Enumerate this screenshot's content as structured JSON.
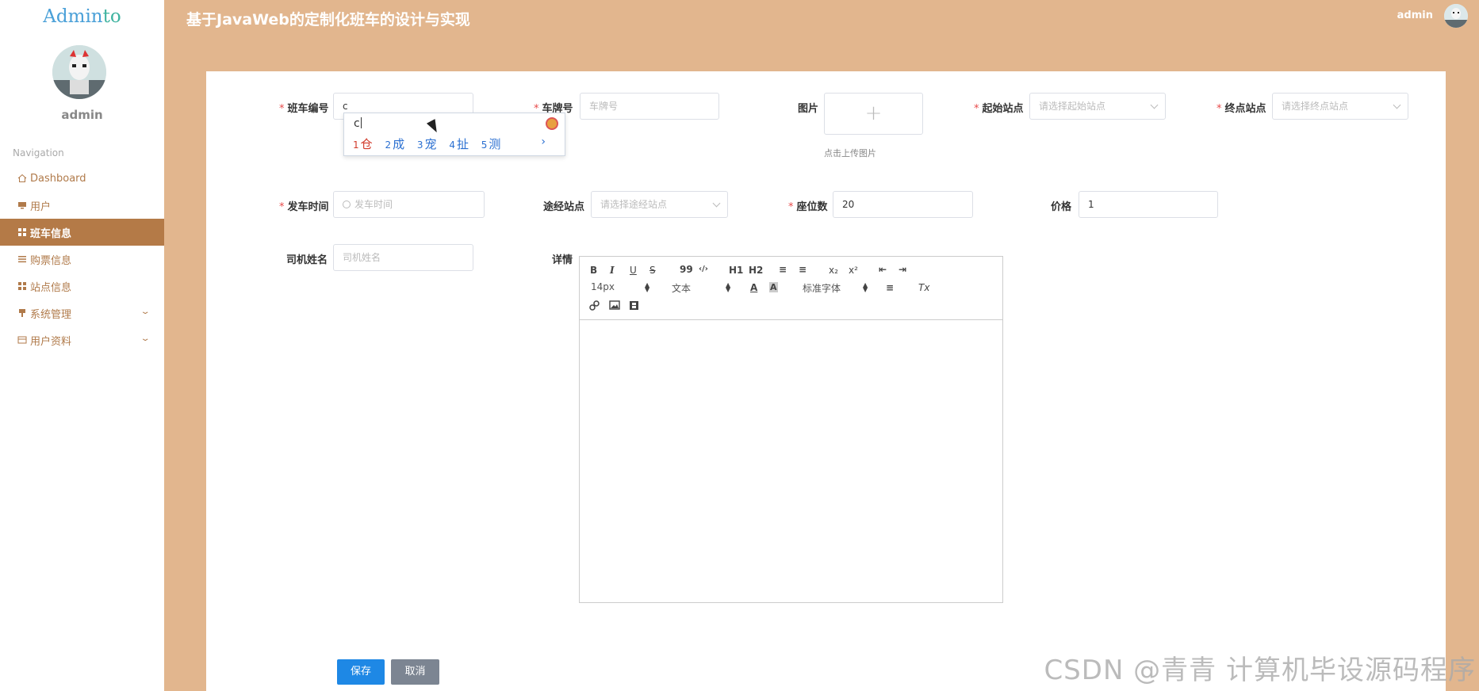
{
  "app": {
    "logo_text_a": "Admin",
    "logo_text_b": "to",
    "title": "基于JavaWeb的定制化班车的设计与实现",
    "top_user": "admin",
    "side_user": "admin"
  },
  "nav": {
    "section_title": "Navigation",
    "items": [
      {
        "label": "Dashboard",
        "icon": "home-icon"
      },
      {
        "label": "用户",
        "icon": "monitor-icon"
      },
      {
        "label": "班车信息",
        "icon": "grid-icon",
        "active": true
      },
      {
        "label": "购票信息",
        "icon": "list-icon"
      },
      {
        "label": "站点信息",
        "icon": "grid-icon"
      },
      {
        "label": "系统管理",
        "icon": "pin-icon",
        "expandable": true
      },
      {
        "label": "用户资料",
        "icon": "card-icon",
        "expandable": true
      }
    ]
  },
  "form": {
    "bus_no_label": "班车编号",
    "bus_no_value": "c",
    "plate_label": "车牌号",
    "plate_placeholder": "车牌号",
    "image_label": "图片",
    "image_tip": "点击上传图片",
    "start_label": "起始站点",
    "start_placeholder": "请选择起始站点",
    "end_label": "终点站点",
    "end_placeholder": "请选择终点站点",
    "depart_label": "发车时间",
    "depart_placeholder": "发车时间",
    "via_label": "途经站点",
    "via_placeholder": "请选择途经站点",
    "seats_label": "座位数",
    "seats_value": "20",
    "price_label": "价格",
    "price_value": "1",
    "driver_label": "司机姓名",
    "driver_placeholder": "司机姓名",
    "detail_label": "详情",
    "save_label": "保存",
    "cancel_label": "取消"
  },
  "ime": {
    "composition": "c",
    "candidates": [
      {
        "num": "1",
        "text": "仓"
      },
      {
        "num": "2",
        "text": "成"
      },
      {
        "num": "3",
        "text": "宠"
      },
      {
        "num": "4",
        "text": "扯"
      },
      {
        "num": "5",
        "text": "测"
      }
    ],
    "next": "›"
  },
  "editor": {
    "font_size": "14px",
    "block_format": "文本",
    "font_family": "标准字体",
    "buttons": {
      "bold": "B",
      "italic": "I",
      "underline": "U",
      "strike": "S",
      "quote": "99",
      "code": "‹/›",
      "h1": "H1",
      "h2": "H2",
      "ordered": "≡",
      "bullet": "≡",
      "sub": "x₂",
      "sup": "x²",
      "outdent": "⇤",
      "indent": "⇥",
      "color": "A",
      "bg": "A",
      "align": "≡",
      "clear": "Tx"
    }
  },
  "watermark": "CSDN @青青  计算机毕设源码程序"
}
